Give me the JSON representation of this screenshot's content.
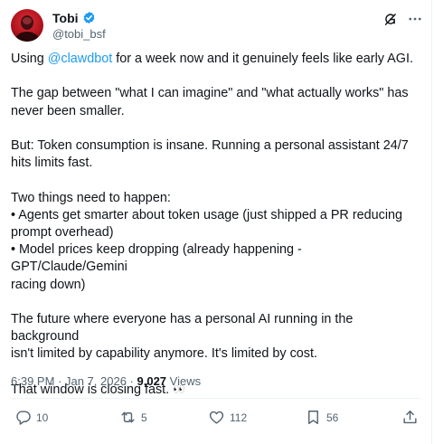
{
  "tweet": {
    "author": {
      "name": "Tobi",
      "handle": "@tobi_bsf"
    },
    "body": {
      "p1_prefix": "Using ",
      "p1_mention": "@clawdbot",
      "p1_suffix": "  for a week now and it genuinely feels like early AGI.",
      "p2_l1": "The gap between \"what I can imagine\" and \"what actually works\" has",
      "p2_l2": "never been smaller.",
      "p3_l1": "But: Token consumption is insane. Running a personal assistant 24/7",
      "p3_l2": "hits limits fast.",
      "p4_l1": "Two things need to happen:",
      "p4_l2": "• Agents get smarter about token usage (just shipped a PR reducing",
      "p4_l3": "prompt overhead)",
      "p4_l4": "• Model prices keep dropping (already happening - GPT/Claude/Gemini",
      "p4_l5": "racing down)",
      "p5_l1": "The future where everyone has a personal AI running in the background",
      "p5_l2": "isn't limited by capability anymore. It's limited by cost.",
      "p6_text": "That window is closing fast. ",
      "p6_emoji": "👀"
    },
    "meta": {
      "time": "6:39 PM",
      "separator": " · ",
      "date": "Jan 7, 2026",
      "views_count": "9,027",
      "views_label": " Views"
    },
    "actions": {
      "replies": "10",
      "reposts": "5",
      "likes": "112",
      "bookmarks": "56"
    }
  },
  "colors": {
    "accent": "#1d9bf0",
    "secondary_text": "#536471",
    "primary_text": "#0f1419"
  },
  "icons": [
    "verified-badge-icon",
    "grok-icon",
    "more-icon",
    "reply-icon",
    "repost-icon",
    "like-icon",
    "bookmark-icon",
    "share-icon"
  ]
}
